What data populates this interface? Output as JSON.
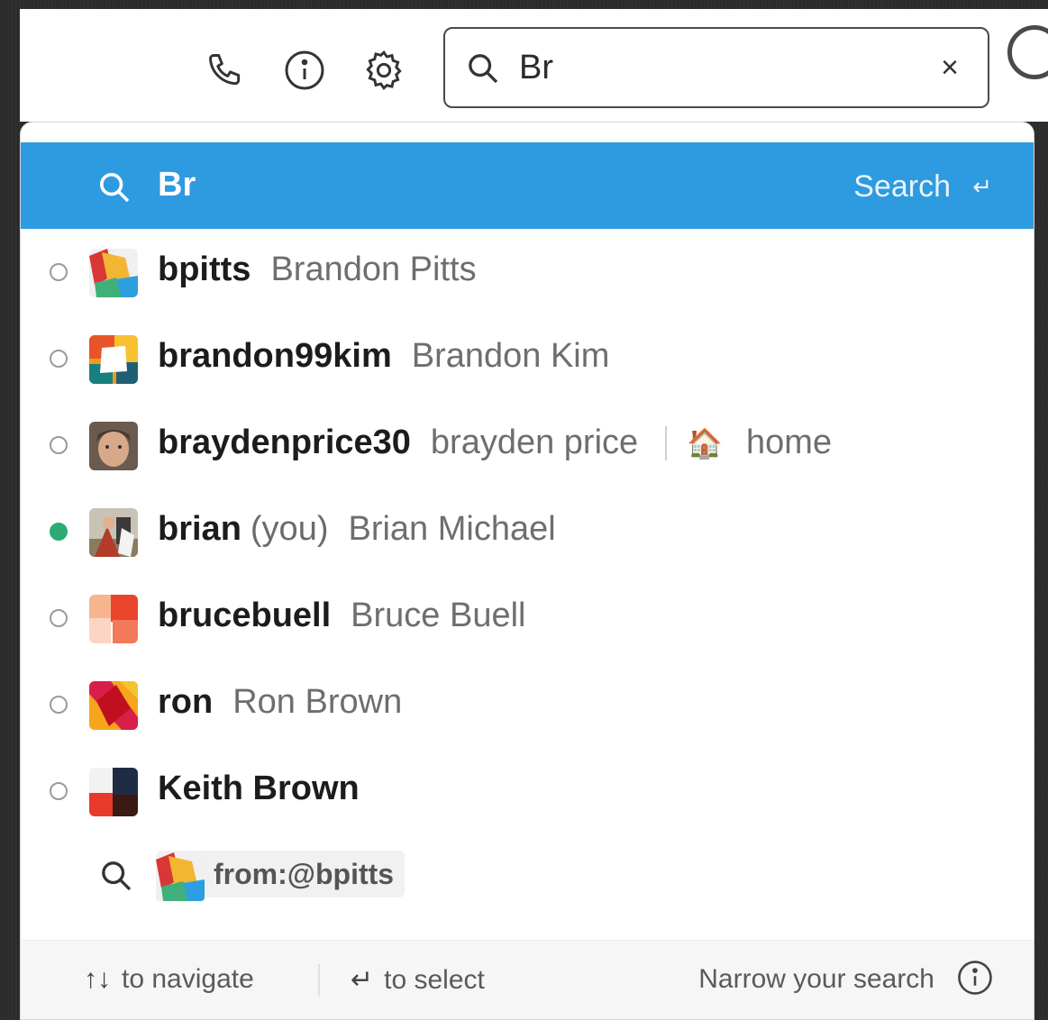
{
  "search": {
    "query": "Br",
    "clear_glyph": "×"
  },
  "toolbar": {
    "icons": [
      "phone-icon",
      "info-icon",
      "gear-icon"
    ]
  },
  "suggestion": {
    "query": "Br",
    "action_label": "Search",
    "enter_glyph": "↵"
  },
  "results": [
    {
      "username": "bpitts",
      "full_name": "Brandon Pitts",
      "presence": "away",
      "you": "",
      "status_emoji": "",
      "status_text": ""
    },
    {
      "username": "brandon99kim",
      "full_name": "Brandon Kim",
      "presence": "away",
      "you": "",
      "status_emoji": "",
      "status_text": ""
    },
    {
      "username": "braydenprice30",
      "full_name": "brayden price",
      "presence": "away",
      "you": "",
      "status_emoji": "🏠",
      "status_text": "home"
    },
    {
      "username": "brian",
      "full_name": "Brian Michael",
      "presence": "online",
      "you": "(you)",
      "status_emoji": "",
      "status_text": ""
    },
    {
      "username": "brucebuell",
      "full_name": "Bruce Buell",
      "presence": "away",
      "you": "",
      "status_emoji": "",
      "status_text": ""
    },
    {
      "username": "ron",
      "full_name": "Ron Brown",
      "presence": "away",
      "you": "",
      "status_emoji": "",
      "status_text": ""
    },
    {
      "username": "Keith Brown",
      "full_name": "",
      "presence": "away",
      "you": "",
      "status_emoji": "",
      "status_text": ""
    }
  ],
  "from_filter": {
    "label": "from:@bpitts"
  },
  "footer": {
    "nav_arrows": "↑↓",
    "nav_hint": "to navigate",
    "select_glyph": "↵",
    "select_hint": "to select",
    "narrow_label": "Narrow your search"
  },
  "colors": {
    "highlight": "#2e9adf",
    "online": "#2bac76"
  }
}
